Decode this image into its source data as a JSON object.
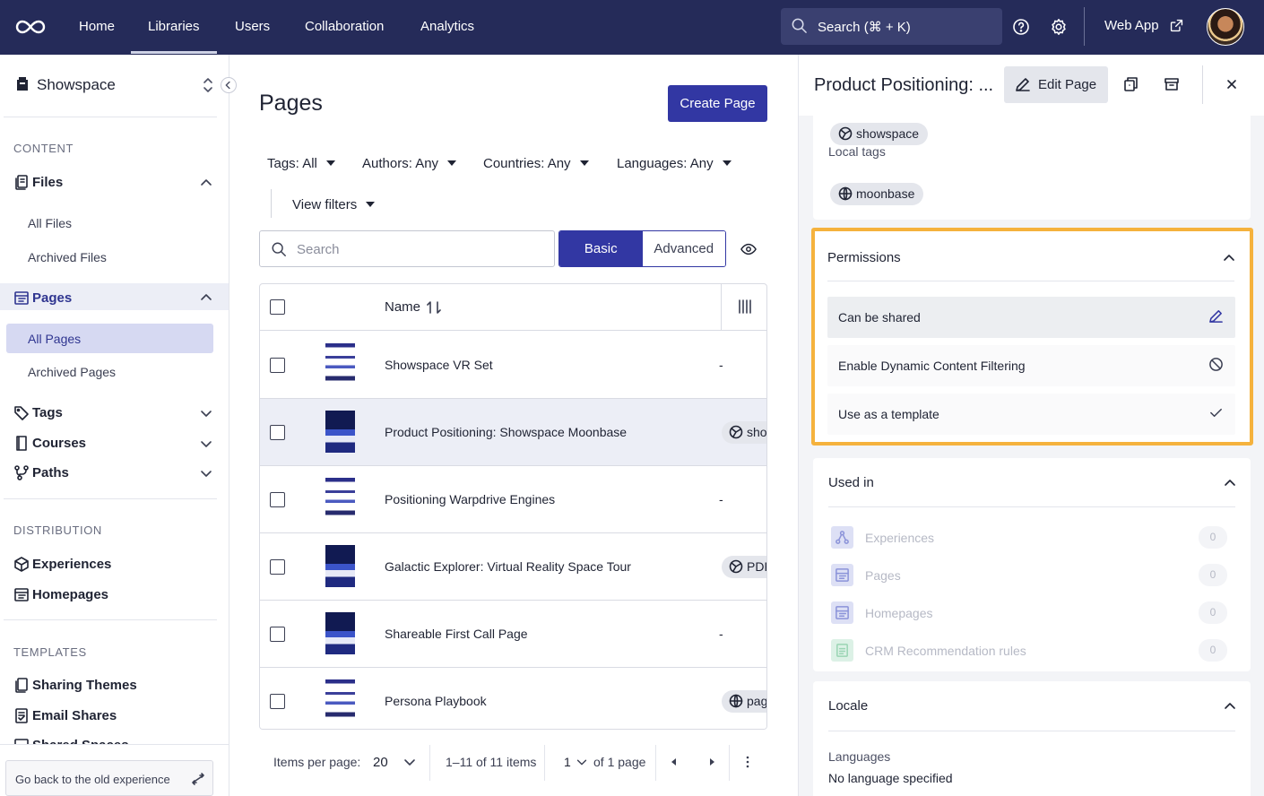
{
  "nav": {
    "tabs": [
      "Home",
      "Libraries",
      "Users",
      "Collaboration",
      "Analytics"
    ],
    "active_tab": "Libraries",
    "search_placeholder": "Search (⌘ + K)",
    "web_app_label": "Web App"
  },
  "sidebar": {
    "workspace": "Showspace",
    "content_heading": "CONTENT",
    "files_label": "Files",
    "all_files": "All Files",
    "archived_files": "Archived Files",
    "pages_label": "Pages",
    "all_pages": "All Pages",
    "archived_pages": "Archived Pages",
    "tags_label": "Tags",
    "courses_label": "Courses",
    "paths_label": "Paths",
    "distribution_heading": "DISTRIBUTION",
    "experiences_label": "Experiences",
    "homepages_label": "Homepages",
    "templates_heading": "TEMPLATES",
    "sharing_themes_label": "Sharing Themes",
    "email_shares_label": "Email Shares",
    "shared_spaces_label": "Shared Spaces",
    "old_experience_label": "Go back to the old experience"
  },
  "main": {
    "title": "Pages",
    "create_button": "Create Page",
    "filters": {
      "tags": "Tags: All",
      "authors": "Authors: Any",
      "countries": "Countries: Any",
      "languages": "Languages: Any",
      "view_filters": "View filters"
    },
    "search_placeholder": "Search",
    "mode_basic": "Basic",
    "mode_advanced": "Advanced",
    "table": {
      "name_header": "Name",
      "rows": [
        {
          "name": "Showspace VR Set",
          "tag": "-"
        },
        {
          "name": "Product Positioning: Showspace Moonbase",
          "tag": "showspace"
        },
        {
          "name": "Positioning Warpdrive Engines",
          "tag": "-"
        },
        {
          "name": "Galactic Explorer: Virtual Reality Space Tour",
          "tag": "PDF"
        },
        {
          "name": "Shareable First Call Page",
          "tag": "-"
        },
        {
          "name": "Persona Playbook",
          "tag": "pages"
        }
      ]
    },
    "pagination": {
      "items_per_page_label": "Items per page:",
      "items_per_page": "20",
      "range": "1–11 of 11 items",
      "page": "1",
      "of_pages": "of 1 page"
    }
  },
  "panel": {
    "title": "Product Positioning: ...",
    "edit_button": "Edit Page",
    "global_tag": "showspace",
    "local_tags_label": "Local tags",
    "local_tag": "moonbase",
    "permissions": {
      "title": "Permissions",
      "items": [
        "Can be shared",
        "Enable Dynamic Content Filtering",
        "Use as a template"
      ]
    },
    "used_in": {
      "title": "Used in",
      "items": [
        {
          "label": "Experiences",
          "count": "0"
        },
        {
          "label": "Pages",
          "count": "0"
        },
        {
          "label": "Homepages",
          "count": "0"
        },
        {
          "label": "CRM Recommendation rules",
          "count": "0"
        }
      ]
    },
    "locale": {
      "title": "Locale",
      "languages_label": "Languages",
      "languages_value": "No language specified"
    }
  },
  "colors": {
    "nav_bg": "#252b59",
    "primary": "#3237a3",
    "highlight_border": "#f5b23d"
  }
}
